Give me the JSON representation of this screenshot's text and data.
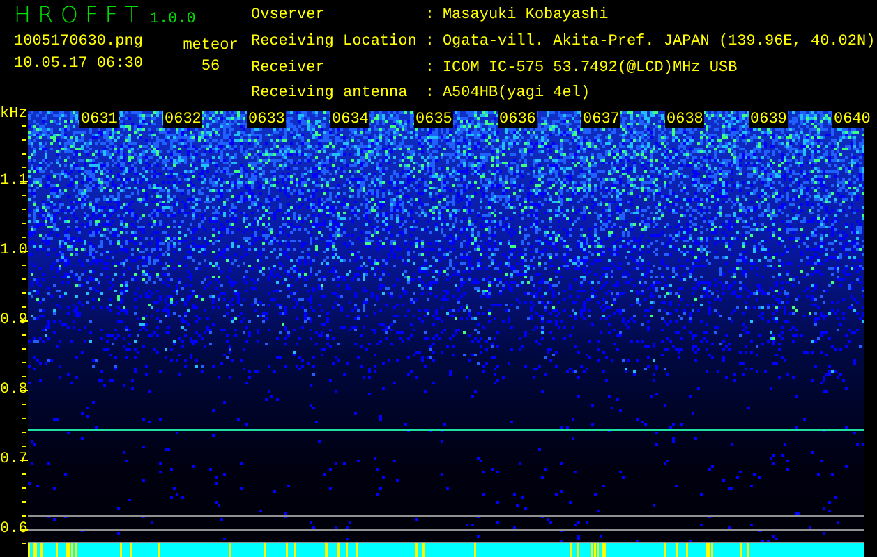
{
  "app": {
    "title": "H R O F F T",
    "version": "1.0.0",
    "file_name": "1005170630.png",
    "date_time": "10.05.17 06:30"
  },
  "meteor": {
    "label": "meteor",
    "count": "56"
  },
  "station_info": [
    {
      "label": "Ovserver",
      "separator": ":",
      "value": "Masayuki Kobayashi"
    },
    {
      "label": "Receiving Location",
      "separator": ":",
      "value": "Ogata-vill. Akita-Pref. JAPAN (139.96E, 40.02N)"
    },
    {
      "label": "Receiver",
      "separator": ":",
      "value": "ICOM IC-575 53.7492(@LCD)MHz USB"
    },
    {
      "label": "Receiving antenna",
      "separator": ":",
      "value": "A504HB(yagi 4el)"
    }
  ],
  "spectrogram": {
    "unit": "kHz",
    "time_labels": [
      "0631",
      "0632",
      "0633",
      "0634",
      "0635",
      "0636",
      "0637",
      "0638",
      "0639",
      "0640"
    ],
    "frequency_labels": [
      "1.1",
      "1.0",
      "0.9",
      "0.8",
      "0.7",
      "0.6"
    ]
  }
}
